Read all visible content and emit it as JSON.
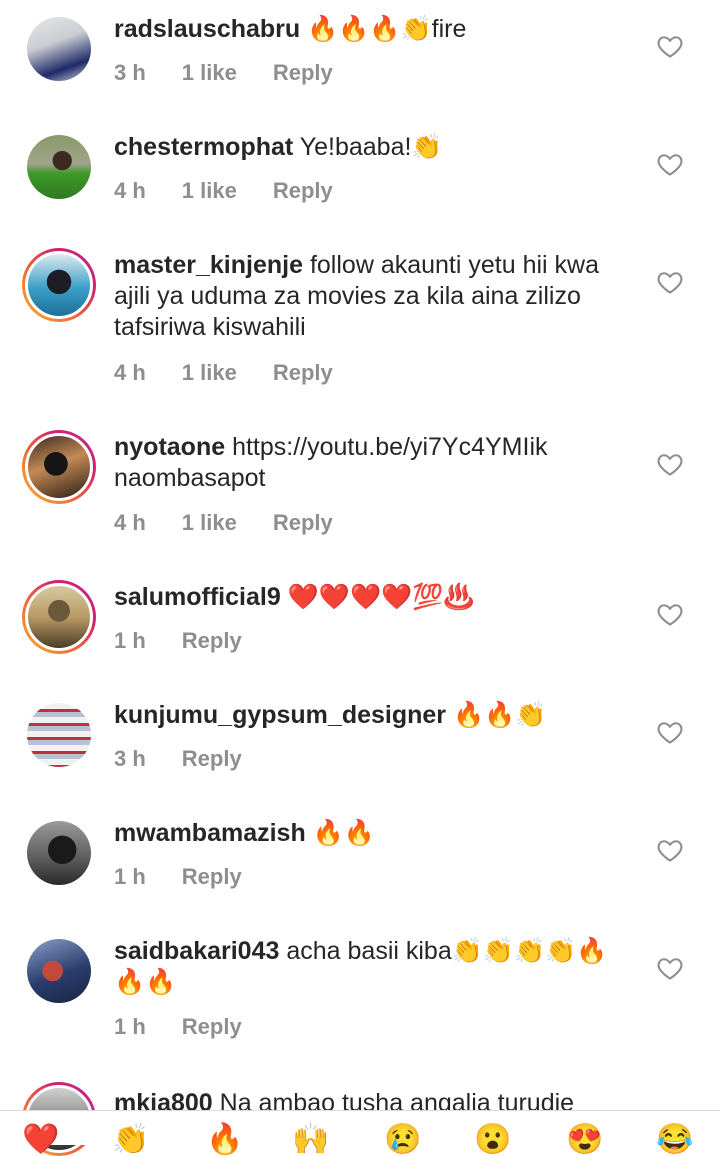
{
  "comments": [
    {
      "username": "radslauschabru",
      "text": "🔥🔥🔥👏fire",
      "time": "3 h",
      "likes": "1 like",
      "reply": "Reply",
      "avatar_ring": false,
      "avatar_colors": [
        "#c9ccd1",
        "#1e2a6a",
        "#e8e8ea"
      ]
    },
    {
      "username": "chestermophat",
      "text": "Ye!baaba!👏",
      "time": "4 h",
      "likes": "1 like",
      "reply": "Reply",
      "avatar_ring": false,
      "avatar_colors": [
        "#8a9a6a",
        "#3e9a2a",
        "#2f3a22"
      ]
    },
    {
      "username": "master_kinjenje",
      "text": "follow akaunti yetu hii kwa ajili ya uduma za movies za kila aina zilizo tafsiriwa kiswahili",
      "time": "4 h",
      "likes": "1 like",
      "reply": "Reply",
      "avatar_ring": true,
      "avatar_colors": [
        "#3aa0c8",
        "#1d1d26",
        "#dfe9ef"
      ]
    },
    {
      "username": "nyotaone",
      "text": "https://youtu.be/yi7Yc4YMIik naombasapot",
      "time": "4 h",
      "likes": "1 like",
      "reply": "Reply",
      "avatar_ring": true,
      "avatar_colors": [
        "#3b2a22",
        "#151515",
        "#c28a55"
      ]
    },
    {
      "username": "salumofficial9",
      "text": "❤️❤️❤️❤️💯♨️",
      "time": "1 h",
      "likes": "",
      "reply": "Reply",
      "avatar_ring": true,
      "avatar_colors": [
        "#b99a64",
        "#6a5a3a",
        "#d8c9a2"
      ]
    },
    {
      "username": "kunjumu_gypsum_designer",
      "text": "🔥🔥👏",
      "time": "3 h",
      "likes": "",
      "reply": "Reply",
      "avatar_ring": false,
      "avatar_colors": [
        "#b7c1d4",
        "#c0303a",
        "#f1f1f1"
      ]
    },
    {
      "username": "mwambamazish",
      "text": "🔥🔥",
      "time": "1 h",
      "likes": "",
      "reply": "Reply",
      "avatar_ring": false,
      "avatar_colors": [
        "#5a5a5a",
        "#1a1a1a",
        "#9a9a9a"
      ]
    },
    {
      "username": "saidbakari043",
      "text": "acha basii kiba👏👏👏👏🔥🔥🔥",
      "time": "1 h",
      "likes": "",
      "reply": "Reply",
      "avatar_ring": false,
      "avatar_colors": [
        "#2b3d6e",
        "#c24a3a",
        "#88a0c8"
      ]
    },
    {
      "username": "mkja800",
      "text": "Na ambao tusha angalia turudie",
      "time": "",
      "likes": "",
      "reply": "",
      "avatar_ring": true,
      "avatar_colors": [
        "#8c8c8c",
        "#2d2d2d",
        "#d0d0d0"
      ]
    }
  ],
  "reactions": [
    "❤️",
    "👏",
    "🔥",
    "🙌",
    "😢",
    "😮",
    "😍",
    "😂"
  ],
  "colors": {
    "text": "#262626",
    "meta": "#8e8e8e",
    "heart_outline": "#8e8e8e"
  }
}
